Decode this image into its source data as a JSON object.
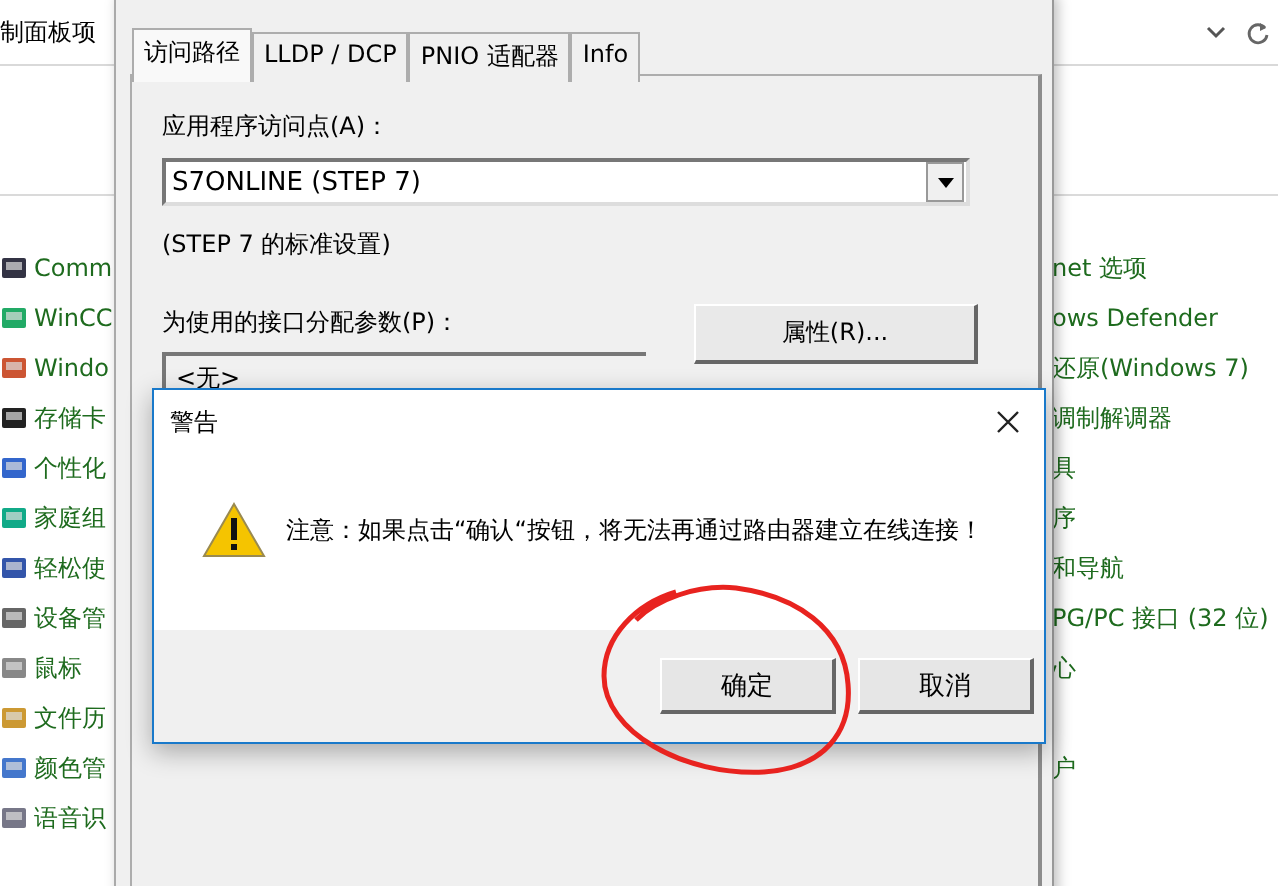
{
  "control_panel": {
    "breadcrumb": "制面板项",
    "left_items": [
      {
        "label": "Comm"
      },
      {
        "label": "WinCC"
      },
      {
        "label": "Windo"
      },
      {
        "label": "存储卡"
      },
      {
        "label": "个性化"
      },
      {
        "label": "家庭组"
      },
      {
        "label": "轻松使"
      },
      {
        "label": "设备管"
      },
      {
        "label": "鼠标"
      },
      {
        "label": "文件历"
      },
      {
        "label": "颜色管"
      },
      {
        "label": "语音识"
      }
    ],
    "right_items": [
      {
        "label": "net 选项"
      },
      {
        "label": "ows Defender"
      },
      {
        "label": "还原(Windows 7)"
      },
      {
        "label": "调制解调器"
      },
      {
        "label": "具"
      },
      {
        "label": "序"
      },
      {
        "label": "和导航"
      },
      {
        "label": "PG/PC 接口 (32 位)"
      },
      {
        "label": "心"
      },
      {
        "label": "户",
        "gap_before": true
      }
    ]
  },
  "settings_dialog": {
    "tabs": [
      {
        "label": "访问路径",
        "selected": true
      },
      {
        "label": "LLDP / DCP",
        "selected": false
      },
      {
        "label": "PNIO 适配器",
        "selected": false
      },
      {
        "label": "Info",
        "selected": false
      }
    ],
    "access_point_label": "应用程序访问点(A)：",
    "access_point_value": "S7ONLINE (STEP 7)",
    "access_point_note": "(STEP 7 的标准设置)",
    "interface_label": "为使用的接口分配参数(P)：",
    "interface_list": [
      "<无>"
    ],
    "properties_button": "属性(R)..."
  },
  "warning_dialog": {
    "title": "警告",
    "message": "注意：如果点击“确认“按钮，将无法再通过路由器建立在线连接！",
    "buttons": [
      "确定",
      "取消"
    ]
  }
}
